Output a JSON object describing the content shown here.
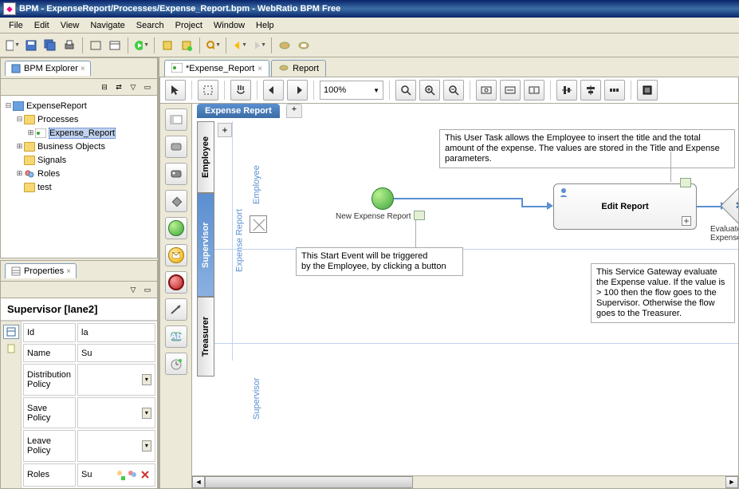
{
  "window_title": "BPM - ExpenseReport/Processes/Expense_Report.bpm - WebRatio BPM Free",
  "menubar": [
    "File",
    "Edit",
    "View",
    "Navigate",
    "Search",
    "Project",
    "Window",
    "Help"
  ],
  "explorer": {
    "tab_label": "BPM Explorer",
    "root": "ExpenseReport",
    "nodes": {
      "processes": "Processes",
      "expense_report": "Expense_Report",
      "business_objects": "Business Objects",
      "signals": "Signals",
      "roles": "Roles",
      "test": "test"
    }
  },
  "properties": {
    "tab_label": "Properties",
    "header": "Supervisor [lane2]",
    "rows": {
      "id_label": "Id",
      "id_value": "la",
      "name_label": "Name",
      "name_value": "Su",
      "dist_label": "Distribution Policy",
      "dist_value": "",
      "save_label": "Save Policy",
      "save_value": "",
      "leave_label": "Leave Policy",
      "leave_value": "",
      "roles_label": "Roles",
      "roles_value": "Su"
    }
  },
  "editor_tabs": {
    "active": "*Expense_Report",
    "inactive": "Report"
  },
  "zoom": "100%",
  "diagram": {
    "pool": "Expense Report",
    "lane_emp": "Employee",
    "lane_sup": "Supervisor",
    "lane_tre": "Treasurer",
    "pool_side_label": "Expense Report",
    "side_emp": "Employee",
    "side_sup": "Supervisor",
    "start_label": "New Expense Report",
    "task_label": "Edit Report",
    "gateway_label": "Evaluate Expense",
    "ann_start": "This Start Event will be triggered\nby the Employee, by clicking a button",
    "ann_task": "This User Task allows the Employee to insert the title and the total amount of the expense. The values are stored in the Title and Expense parameters.",
    "ann_gw": "This Service Gateway evaluate the Expense value. If the value is > 100 then the flow goes to the Supervisor. Otherwise the flow goes to the Treasurer."
  }
}
